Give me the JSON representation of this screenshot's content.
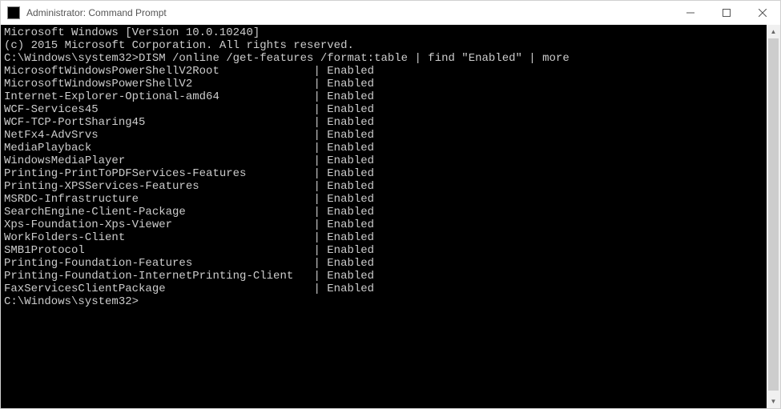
{
  "window": {
    "title": "Administrator: Command Prompt",
    "icon_label": "C:\\"
  },
  "header": {
    "line1": "Microsoft Windows [Version 10.0.10240]",
    "line2": "(c) 2015 Microsoft Corporation. All rights reserved."
  },
  "prompt1": {
    "path": "C:\\Windows\\system32>",
    "command": "DISM /online /get-features /format:table | find \"Enabled\" | more"
  },
  "features": [
    {
      "name": "MicrosoftWindowsPowerShellV2Root",
      "status": "Enabled"
    },
    {
      "name": "MicrosoftWindowsPowerShellV2",
      "status": "Enabled"
    },
    {
      "name": "Internet-Explorer-Optional-amd64",
      "status": "Enabled"
    },
    {
      "name": "WCF-Services45",
      "status": "Enabled"
    },
    {
      "name": "WCF-TCP-PortSharing45",
      "status": "Enabled"
    },
    {
      "name": "NetFx4-AdvSrvs",
      "status": "Enabled"
    },
    {
      "name": "MediaPlayback",
      "status": "Enabled"
    },
    {
      "name": "WindowsMediaPlayer",
      "status": "Enabled"
    },
    {
      "name": "Printing-PrintToPDFServices-Features",
      "status": "Enabled"
    },
    {
      "name": "Printing-XPSServices-Features",
      "status": "Enabled"
    },
    {
      "name": "MSRDC-Infrastructure",
      "status": "Enabled"
    },
    {
      "name": "SearchEngine-Client-Package",
      "status": "Enabled"
    },
    {
      "name": "Xps-Foundation-Xps-Viewer",
      "status": "Enabled"
    },
    {
      "name": "WorkFolders-Client",
      "status": "Enabled"
    },
    {
      "name": "SMB1Protocol",
      "status": "Enabled"
    },
    {
      "name": "Printing-Foundation-Features",
      "status": "Enabled"
    },
    {
      "name": "Printing-Foundation-InternetPrinting-Client",
      "status": "Enabled"
    },
    {
      "name": "FaxServicesClientPackage",
      "status": "Enabled"
    }
  ],
  "prompt2": {
    "path": "C:\\Windows\\system32>"
  },
  "table_format": {
    "name_col_width": 46
  }
}
